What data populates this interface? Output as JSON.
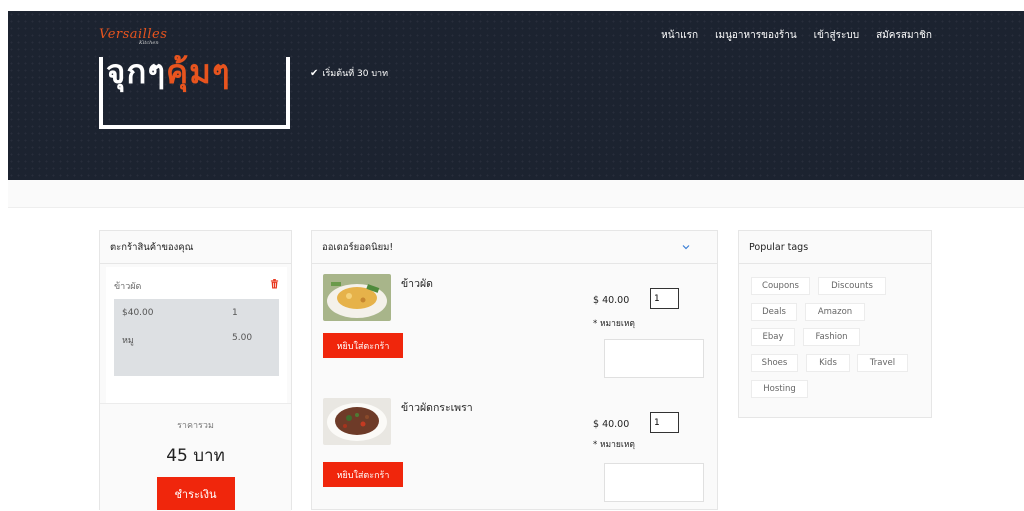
{
  "brand": {
    "name": "Versailles",
    "sub": "Kitchen"
  },
  "nav": [
    "หน้าแรก",
    "เมนูอาหารของร้าน",
    "เข้าสู่ระบบ",
    "สมัครสมาชิก"
  ],
  "hero": {
    "headline_main": "จุกๆ",
    "headline_accent": "คุ้มๆ",
    "tagline": "เริ่มต้นที่ 30 บาท"
  },
  "colors": {
    "accent": "#e8541e",
    "button": "#f0260c",
    "hero_bg": "#1c2330"
  },
  "cart": {
    "title": "ตะกร้าสินค้าของคุณ",
    "item_name": "ข้าวผัด",
    "rows": [
      {
        "label": "$40.00",
        "value": "1"
      },
      {
        "label": "หมู",
        "value": "5.00"
      }
    ],
    "total_label": "ราคารวม",
    "total_value": "45 บาท",
    "pay_label": "ชำระเงิน"
  },
  "orders": {
    "title": "ออเดอร์ยอดนิยม!",
    "items": [
      {
        "name": "ข้าวผัด",
        "price": "$ 40.00",
        "qty": "1",
        "note_label": "* หมายเหตุ",
        "add_label": "หยิบใส่ตะกร้า"
      },
      {
        "name": "ข้าวผัดกระเพรา",
        "price": "$ 40.00",
        "qty": "1",
        "note_label": "* หมายเหตุ",
        "add_label": "หยิบใส่ตะกร้า"
      }
    ]
  },
  "tags": {
    "title": "Popular tags",
    "items": [
      "Coupons",
      "Discounts",
      "Deals",
      "Amazon",
      "Ebay",
      "Fashion",
      "Shoes",
      "Kids",
      "Travel",
      "Hosting"
    ]
  }
}
